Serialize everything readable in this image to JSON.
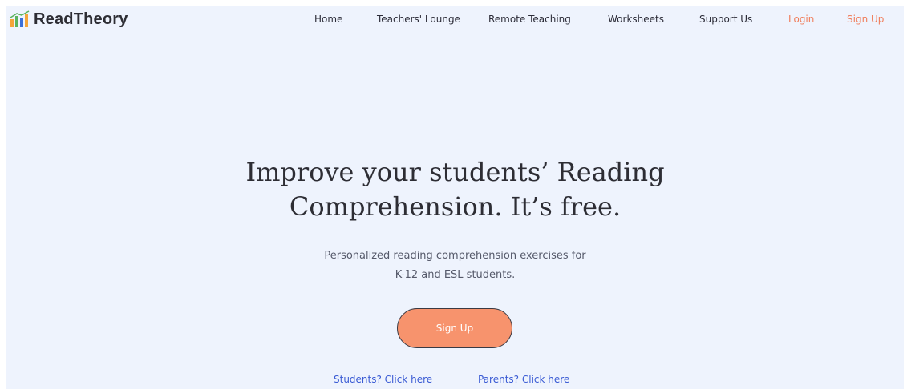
{
  "brand": {
    "name": "ReadTheory",
    "logo_colors": [
      "#f4a53a",
      "#5bb35d",
      "#3b6fd9"
    ]
  },
  "nav": {
    "home": "Home",
    "teachers_lounge": "Teachers' Lounge",
    "remote_teaching": "Remote Teaching",
    "worksheets": "Worksheets",
    "support_us": "Support Us",
    "login": "Login",
    "sign_up": "Sign Up"
  },
  "hero": {
    "title_line1": "Improve your students’ Reading",
    "title_line2": "Comprehension. It’s free.",
    "subtitle_line1": "Personalized reading comprehension exercises for",
    "subtitle_line2": "K-12 and ESL students.",
    "cta_label": "Sign Up",
    "students_link": "Students? Click here",
    "parents_link": "Parents? Click here"
  },
  "colors": {
    "background": "#eef3fd",
    "accent": "#f07d5a",
    "cta_fill": "#f7936d",
    "link": "#3a5bd4"
  }
}
